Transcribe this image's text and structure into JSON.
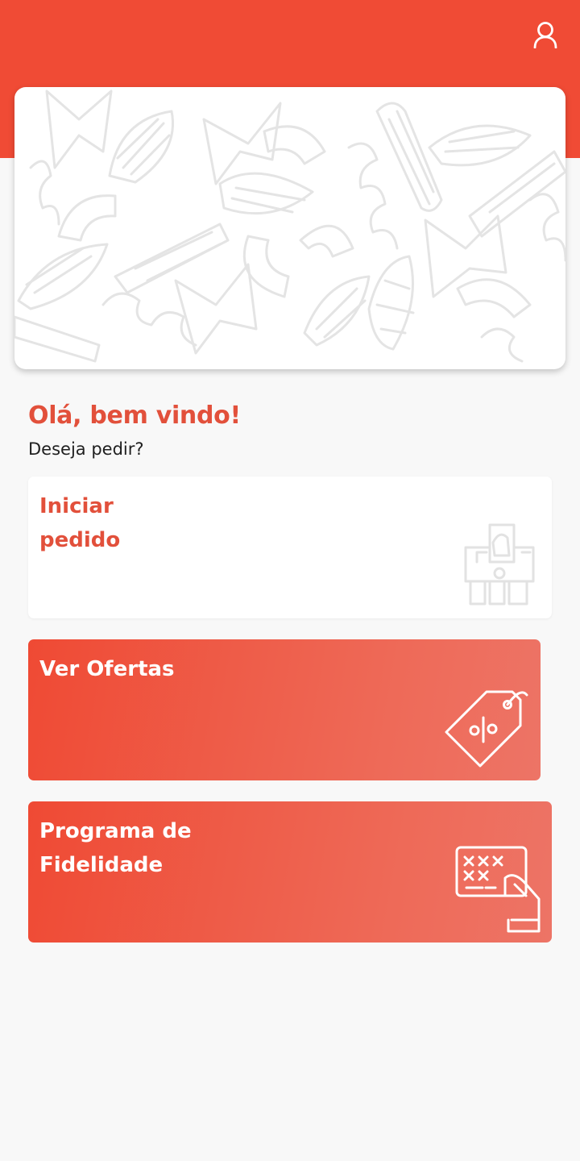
{
  "header": {
    "background_color": "#f04b35",
    "profile_icon": "user-icon"
  },
  "banner": {
    "pattern": "pasta-doodle-pattern"
  },
  "welcome": {
    "greeting": "Olá, bem vindo!",
    "subtitle": "Deseja pedir?"
  },
  "cards": {
    "start_order": {
      "line1": "Iniciar",
      "line2": "pedido",
      "icon": "cash-register-icon"
    },
    "offers": {
      "label": "Ver Ofertas",
      "icon": "discount-tag-icon"
    },
    "loyalty": {
      "line1": "Programa de",
      "line2": "Fidelidade",
      "icon": "card-in-hand-icon"
    }
  },
  "colors": {
    "accent": "#f04b35",
    "heading_red": "#e2503b",
    "background": "#f8f8f8"
  }
}
